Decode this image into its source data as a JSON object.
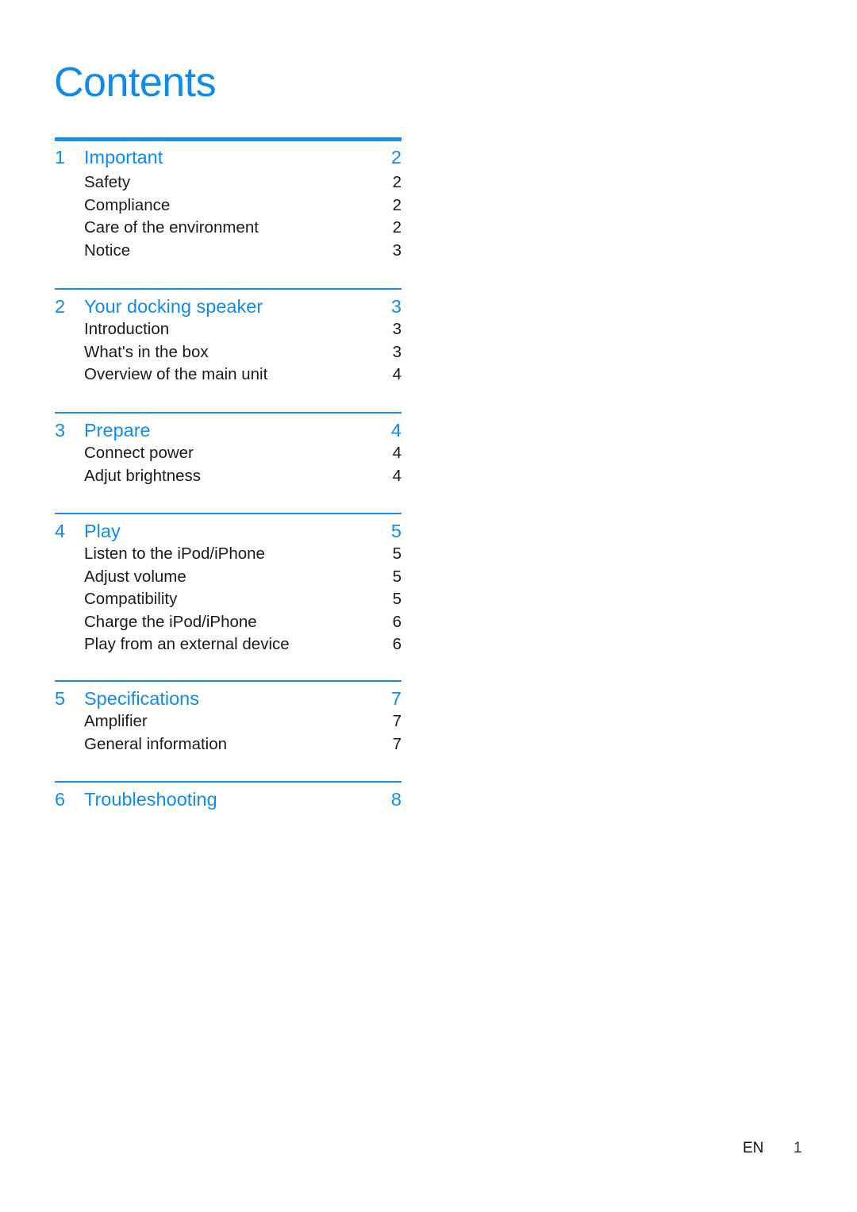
{
  "title": "Contents",
  "accent_color": "#0d8cf0",
  "sections": [
    {
      "number": "1",
      "title": "Important",
      "page": "2",
      "items": [
        {
          "title": "Safety",
          "page": "2"
        },
        {
          "title": "Compliance",
          "page": "2"
        },
        {
          "title": "Care of the environment",
          "page": "2"
        },
        {
          "title": "Notice",
          "page": "3"
        }
      ]
    },
    {
      "number": "2",
      "title": "Your docking speaker",
      "page": "3",
      "items": [
        {
          "title": "Introduction",
          "page": "3"
        },
        {
          "title": "What's in the box",
          "page": "3"
        },
        {
          "title": "Overview of the main unit",
          "page": "4"
        }
      ]
    },
    {
      "number": "3",
      "title": "Prepare",
      "page": "4",
      "items": [
        {
          "title": "Connect power",
          "page": "4"
        },
        {
          "title": "Adjut brightness",
          "page": "4"
        }
      ]
    },
    {
      "number": "4",
      "title": "Play",
      "page": "5",
      "items": [
        {
          "title": "Listen to the iPod/iPhone",
          "page": "5"
        },
        {
          "title": "Adjust volume",
          "page": "5"
        },
        {
          "title": "Compatibility",
          "page": "5"
        },
        {
          "title": "Charge the iPod/iPhone",
          "page": "6"
        },
        {
          "title": "Play from an external device",
          "page": "6"
        }
      ]
    },
    {
      "number": "5",
      "title": "Specifications",
      "page": "7",
      "items": [
        {
          "title": "Amplifier",
          "page": "7"
        },
        {
          "title": "General information",
          "page": "7"
        }
      ]
    },
    {
      "number": "6",
      "title": "Troubleshooting",
      "page": "8",
      "items": []
    }
  ],
  "footer": {
    "language": "EN",
    "page_number": "1"
  }
}
